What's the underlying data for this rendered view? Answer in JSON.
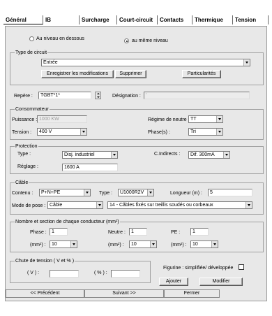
{
  "tabs": [
    {
      "label": "Général"
    },
    {
      "label": "IB"
    },
    {
      "label": "Surcharge"
    },
    {
      "label": "Court-circuit"
    },
    {
      "label": "Contacts"
    },
    {
      "label": "Thermique"
    },
    {
      "label": "Tension"
    }
  ],
  "level": {
    "option1": "Au niveau en dessous",
    "option2": "au même niveau",
    "selected": "au même niveau"
  },
  "circuit": {
    "group_label": "Type de circuit",
    "value": "Entrée",
    "save_label": "Enregistrer les modifications",
    "delete_label": "Supprimer",
    "special_label": "Particularités"
  },
  "repere": {
    "label": "Repère :",
    "value": "TGBT*1*",
    "designation_label": "Désignation :",
    "designation_value": "'"
  },
  "consommateur": {
    "group_label": "Consommateur",
    "puissance_label": "Puissance :",
    "puissance_value": "1000 KW",
    "tension_label": "Tension :",
    "tension_value": "400 V",
    "regime_label": "Régime de neutre :",
    "regime_value": "TT",
    "phases_label": "Phase(s) :",
    "phases_value": "Tri"
  },
  "protection": {
    "group_label": "Protection",
    "type_label": "Type :",
    "type_value": "Disj. industriel",
    "cindirects_label": "C.Indirects :",
    "cindirects_value": "Dif. 300mA",
    "reglage_label": "Réglage :",
    "reglage_value": "1600 A"
  },
  "cable": {
    "group_label": "Câble",
    "contenu_label": "Contenu :",
    "contenu_value": "P+N+PE",
    "type_label": "Type :",
    "type_value": "U1000R2V",
    "longueur_label": "Longueur (m) :",
    "longueur_value": "5",
    "pose_label": "Mode de pose :",
    "pose_value": "Câble",
    "pose_detail": "14 - Câbles fixés sur treillis soudés ou corbeaux"
  },
  "section": {
    "group_label": "Nombre et section de chaque conducteur (mm²)",
    "phase_label": "Phase :",
    "phase_value": "1",
    "neutre_label": "Neutre :",
    "neutre_value": "1",
    "pe_label": "PE :",
    "pe_value": "1",
    "mm2_label": "(mm²) :",
    "phase_mm2": "10",
    "neutre_mm2": "10",
    "pe_mm2": "10"
  },
  "chute": {
    "group_label": "Chute de tension ( V et % )",
    "v_label": "( V ) :",
    "pct_label": "( % ) :",
    "v_value": "",
    "pct_value": ""
  },
  "figurine": {
    "label": "Figurine : simplifiée/ développée"
  },
  "actions": {
    "ajouter": "Ajouter",
    "modifier": "Modifier"
  },
  "footer": {
    "prev": "<< Précédent",
    "next": "Suivant >>",
    "close": "Fermer"
  }
}
